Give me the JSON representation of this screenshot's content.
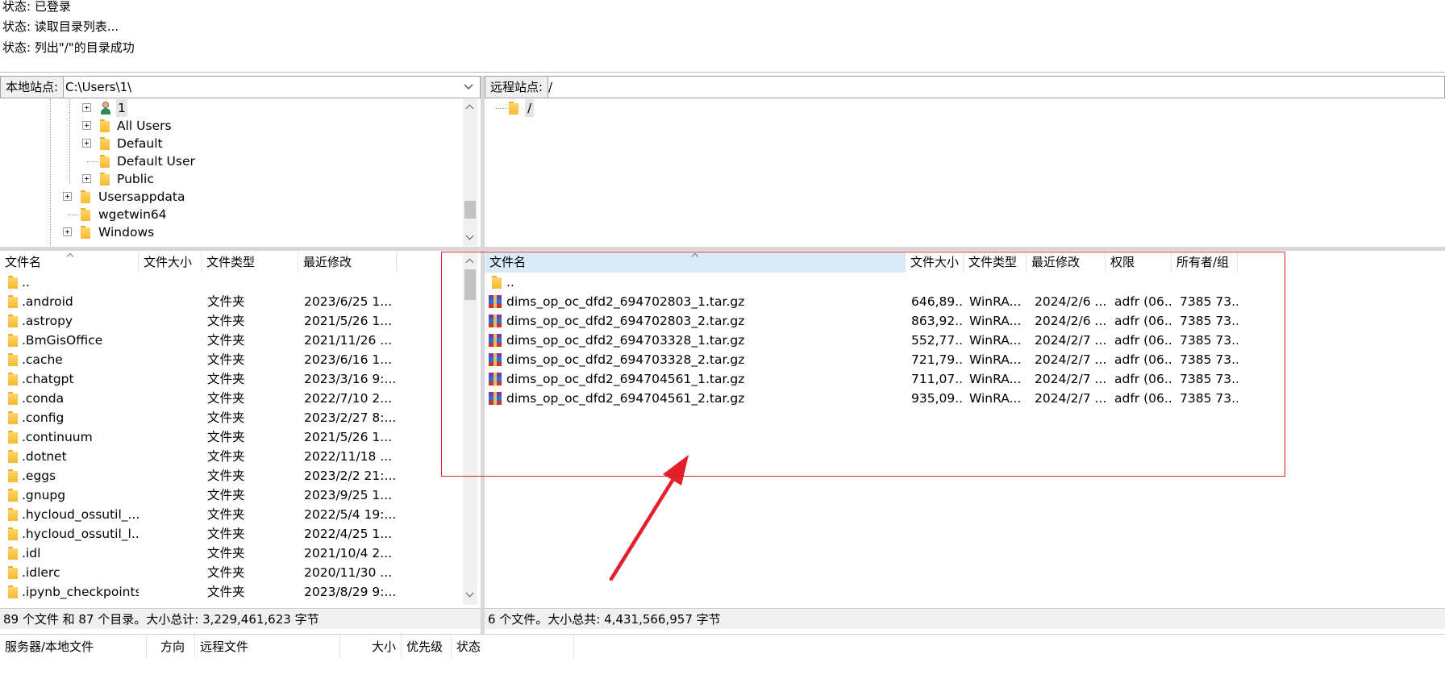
{
  "status_log": [
    {
      "label": "状态:",
      "text": "已登录"
    },
    {
      "label": "状态:",
      "text": "读取目录列表..."
    },
    {
      "label": "状态:",
      "text": "列出\"/\"的目录成功"
    }
  ],
  "local_site": {
    "label": "本地站点:",
    "path": "C:\\Users\\1\\",
    "tree": [
      "1",
      "All Users",
      "Default",
      "Default User",
      "Public",
      "Usersappdata",
      "wgetwin64",
      "Windows"
    ]
  },
  "remote_site": {
    "label": "远程站点:",
    "path": "/",
    "tree": [
      "/"
    ]
  },
  "local_list": {
    "headers": [
      "文件名",
      "文件大小",
      "文件类型",
      "最近修改"
    ],
    "rows": [
      {
        "name": "..",
        "size": "",
        "type": "",
        "modified": ""
      },
      {
        "name": ".android",
        "size": "",
        "type": "文件夹",
        "modified": "2023/6/25 1..."
      },
      {
        "name": ".astropy",
        "size": "",
        "type": "文件夹",
        "modified": "2021/5/26 1..."
      },
      {
        "name": ".BmGisOffice",
        "size": "",
        "type": "文件夹",
        "modified": "2021/11/26 ..."
      },
      {
        "name": ".cache",
        "size": "",
        "type": "文件夹",
        "modified": "2023/6/16 1..."
      },
      {
        "name": ".chatgpt",
        "size": "",
        "type": "文件夹",
        "modified": "2023/3/16 9:..."
      },
      {
        "name": ".conda",
        "size": "",
        "type": "文件夹",
        "modified": "2022/7/10 2..."
      },
      {
        "name": ".config",
        "size": "",
        "type": "文件夹",
        "modified": "2023/2/27 8:..."
      },
      {
        "name": ".continuum",
        "size": "",
        "type": "文件夹",
        "modified": "2021/5/26 1..."
      },
      {
        "name": ".dotnet",
        "size": "",
        "type": "文件夹",
        "modified": "2022/11/18 ..."
      },
      {
        "name": ".eggs",
        "size": "",
        "type": "文件夹",
        "modified": "2023/2/2 21:..."
      },
      {
        "name": ".gnupg",
        "size": "",
        "type": "文件夹",
        "modified": "2023/9/25 1..."
      },
      {
        "name": ".hycloud_ossutil_...",
        "size": "",
        "type": "文件夹",
        "modified": "2022/5/4 19:..."
      },
      {
        "name": ".hycloud_ossutil_l...",
        "size": "",
        "type": "文件夹",
        "modified": "2022/4/25 1..."
      },
      {
        "name": ".idl",
        "size": "",
        "type": "文件夹",
        "modified": "2021/10/4 2..."
      },
      {
        "name": ".idlerc",
        "size": "",
        "type": "文件夹",
        "modified": "2020/11/30 ..."
      },
      {
        "name": ".ipynb_checkpoints",
        "size": "",
        "type": "文件夹",
        "modified": "2023/8/29 9:..."
      }
    ],
    "status": "89 个文件 和 87 个目录。大小总计: 3,229,461,623 字节"
  },
  "remote_list": {
    "headers": [
      "文件名",
      "文件大小",
      "文件类型",
      "最近修改",
      "权限",
      "所有者/组"
    ],
    "rows": [
      {
        "name": "..",
        "size": "",
        "type": "",
        "modified": "",
        "perm": "",
        "owner": ""
      },
      {
        "name": "dims_op_oc_dfd2_694702803_1.tar.gz",
        "size": "646,89...",
        "type": "WinRA...",
        "modified": "2024/2/6 ...",
        "perm": "adfr (06...",
        "owner": "7385 73..."
      },
      {
        "name": "dims_op_oc_dfd2_694702803_2.tar.gz",
        "size": "863,92...",
        "type": "WinRA...",
        "modified": "2024/2/6 ...",
        "perm": "adfr (06...",
        "owner": "7385 73..."
      },
      {
        "name": "dims_op_oc_dfd2_694703328_1.tar.gz",
        "size": "552,77...",
        "type": "WinRA...",
        "modified": "2024/2/7 ...",
        "perm": "adfr (06...",
        "owner": "7385 73..."
      },
      {
        "name": "dims_op_oc_dfd2_694703328_2.tar.gz",
        "size": "721,79...",
        "type": "WinRA...",
        "modified": "2024/2/7 ...",
        "perm": "adfr (06...",
        "owner": "7385 73..."
      },
      {
        "name": "dims_op_oc_dfd2_694704561_1.tar.gz",
        "size": "711,07...",
        "type": "WinRA...",
        "modified": "2024/2/7 ...",
        "perm": "adfr (06...",
        "owner": "7385 73..."
      },
      {
        "name": "dims_op_oc_dfd2_694704561_2.tar.gz",
        "size": "935,09...",
        "type": "WinRA...",
        "modified": "2024/2/7 ...",
        "perm": "adfr (06...",
        "owner": "7385 73..."
      }
    ],
    "status": "6 个文件。大小总共: 4,431,566,957 字节"
  },
  "queue": {
    "headers": [
      "服务器/本地文件",
      "方向",
      "远程文件",
      "大小",
      "优先级",
      "状态"
    ]
  },
  "colors": {
    "annotation_red": "#e41f2b",
    "sorted_header_bg": "#d9ebf9",
    "folder_yellow": "#f4b92f"
  },
  "icons": {
    "folder": "folder-icon",
    "user": "user-folder-icon",
    "archive": "winrar-archive-icon",
    "expand": "expand-plus-icon"
  }
}
